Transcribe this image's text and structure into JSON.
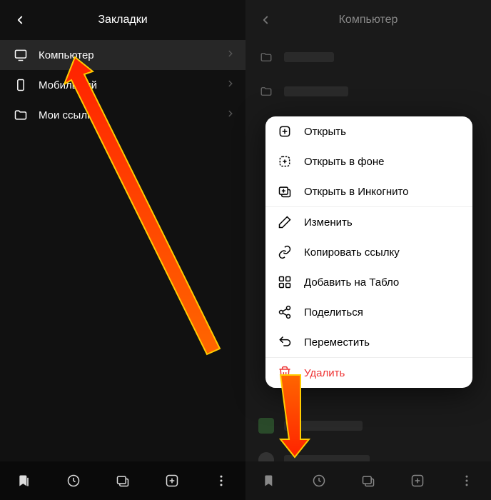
{
  "left": {
    "title": "Закладки",
    "items": [
      {
        "label": "Компьютер",
        "icon": "monitor"
      },
      {
        "label": "Мобильный",
        "icon": "phone"
      },
      {
        "label": "Мои ссылки",
        "icon": "folder"
      }
    ]
  },
  "right": {
    "title": "Компьютер"
  },
  "context_menu": {
    "groups": [
      [
        {
          "label": "Открыть",
          "icon": "open"
        },
        {
          "label": "Открыть в фоне",
          "icon": "open-bg"
        },
        {
          "label": "Открыть в Инкогнито",
          "icon": "incognito"
        }
      ],
      [
        {
          "label": "Изменить",
          "icon": "edit"
        },
        {
          "label": "Копировать ссылку",
          "icon": "link"
        },
        {
          "label": "Добавить на Табло",
          "icon": "dashboard"
        },
        {
          "label": "Поделиться",
          "icon": "share"
        },
        {
          "label": "Переместить",
          "icon": "move"
        }
      ],
      [
        {
          "label": "Удалить",
          "icon": "trash",
          "danger": true
        }
      ]
    ]
  },
  "bottombar": {
    "icons": [
      "bookmark",
      "history",
      "tabs",
      "newtab",
      "more"
    ]
  }
}
